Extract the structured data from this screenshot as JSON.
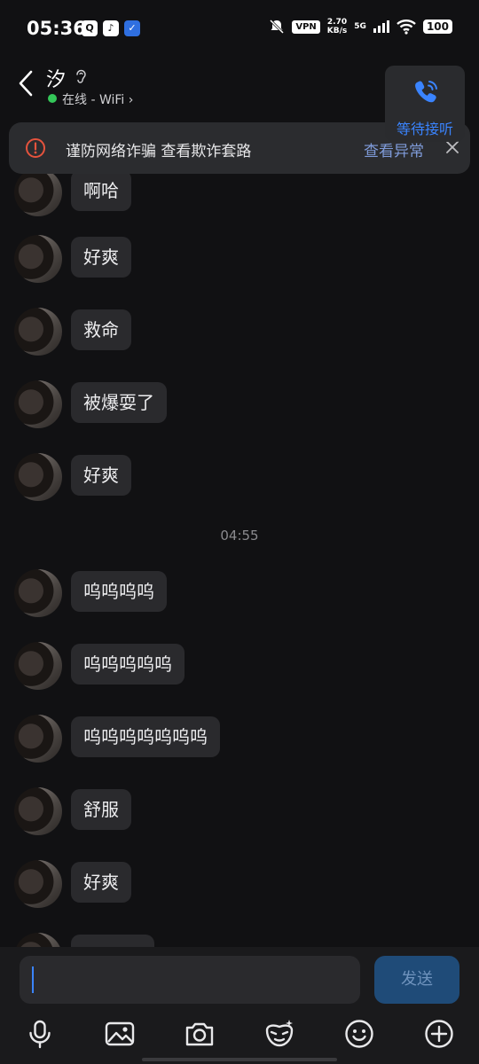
{
  "status_bar": {
    "time": "05:36",
    "vpn": "VPN",
    "net_speed_value": "2.70",
    "net_speed_unit": "KB/s",
    "network": "5G",
    "battery": "100"
  },
  "header": {
    "contact_name": "汐",
    "status": "在线 - WiFi",
    "status_chevron": "›"
  },
  "call_card": {
    "label": "等待接听",
    "accent": "#3a84ff"
  },
  "banner": {
    "text": "谨防网络诈骗 查看欺诈套路",
    "link": "查看异常"
  },
  "messages": [
    {
      "text": "啊哈"
    },
    {
      "text": "好爽"
    },
    {
      "text": "救命"
    },
    {
      "text": "被爆耍了"
    },
    {
      "text": "好爽"
    },
    {
      "text": "呜呜呜呜"
    },
    {
      "text": "呜呜呜呜呜"
    },
    {
      "text": "呜呜呜呜呜呜呜"
    },
    {
      "text": "舒服"
    },
    {
      "text": "好爽"
    },
    {
      "text": ""
    }
  ],
  "timestamp": "04:55",
  "composer": {
    "value": "",
    "send_label": "发送"
  },
  "toolbar": [
    "mic-icon",
    "image-icon",
    "camera-icon",
    "sticker-icon",
    "emoji-icon",
    "plus-icon"
  ]
}
